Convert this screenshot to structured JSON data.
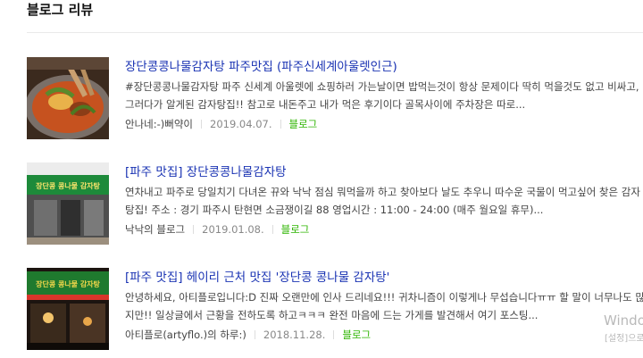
{
  "section": {
    "title": "블로그 리뷰"
  },
  "reviews": [
    {
      "title": "장단콩콩나물감자탕 파주맛집 (파주신세계아울렛인근)",
      "description": "#장단콩콩나물감자탕 파주 신세계 아울렛에 쇼핑하러 가는날이면 밥먹는것이 항상 문제이다 딱히 먹을것도 없고 비싸고,\n그러다가 알게된 감자탕집!! 참고로 내돈주고 내가 먹은 후기이다 골목사이에 주차장은 따로...",
      "author": "안나네:-)뻐약이",
      "date": "2019.04.07.",
      "source": "블로그"
    },
    {
      "title": "[파주 맛집] 장단콩콩나물감자탕",
      "description": "연차내고 파주로 당일치기 다녀온 뀨와 낙낙 점심 뭐먹을까 하고 찾아보다 날도 추우니 따수운 국물이 먹고싶어 찾은 감자\n탕집! 주소 : 경기 파주시 탄현면 소금쟁이길 88 영업시간 : 11:00 - 24:00 (매주 월요일 휴무)...",
      "author": "낙낙의 블로그",
      "date": "2019.01.08.",
      "source": "블로그"
    },
    {
      "title": "[파주 맛집] 헤이리 근처 맛집 '장단콩 콩나물 감자탕'",
      "description": "안녕하세요, 아티플로입니다:D 진짜 오랜만에 인사 드리네요!!! 귀차니즘이 이렇게나 무섭습니다ㅠㅠ 할 말이 너무나도 많\n지만!! 일상글에서 근황을 전하도록 하고ㅋㅋㅋ 완전 마음에 드는 가게를 발견해서 여기 포스팅...",
      "author": "아티플로(artyflo.)의 하루:)",
      "date": "2018.11.28.",
      "source": "블로그"
    }
  ],
  "thumb_text": {
    "sign1": "장단콩 콩나물 감자탕",
    "sign2": "장단콩 콩나물 감자탕"
  },
  "watermark": {
    "line1": "Windo",
    "line2": "[설정]으로"
  }
}
